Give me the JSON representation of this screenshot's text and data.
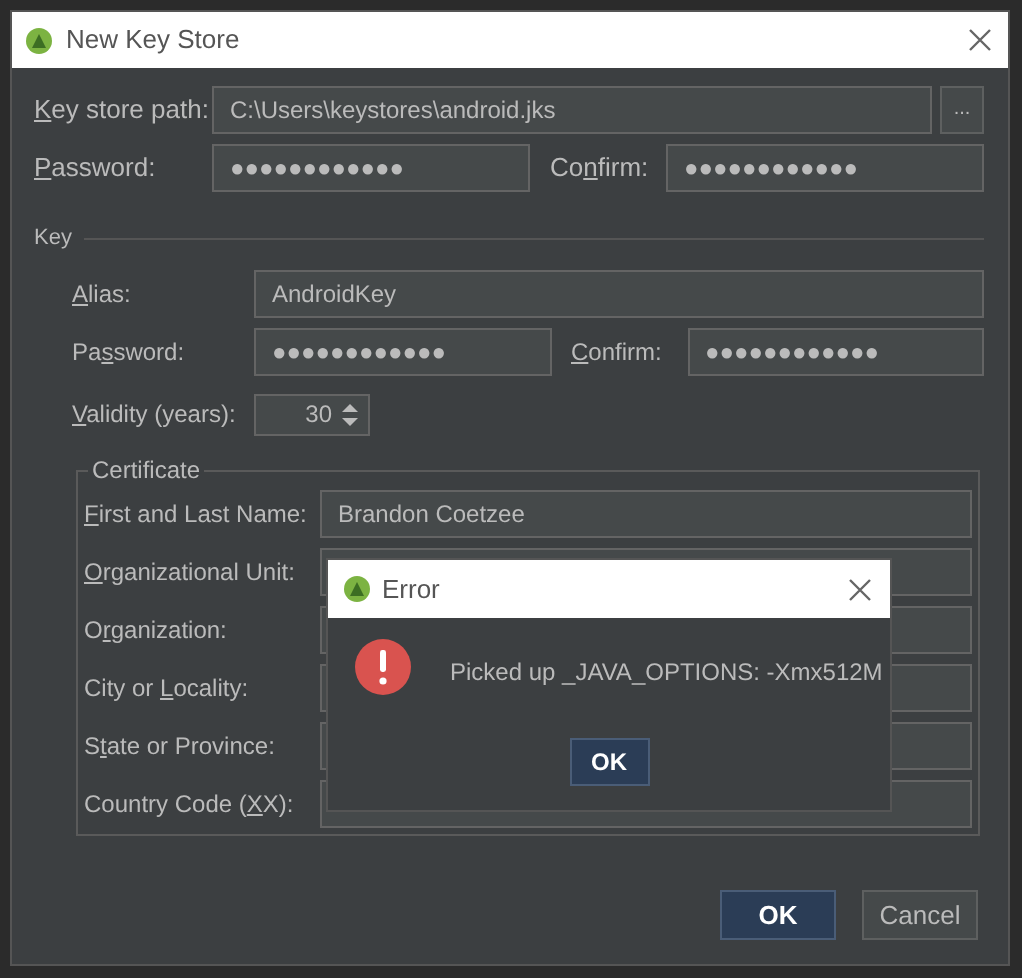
{
  "window": {
    "title": "New Key Store"
  },
  "key_store": {
    "path": {
      "mnemonic": "K",
      "label_post": "ey store path:",
      "value": "C:\\Users\\keystores\\android.jks"
    },
    "browse_button": "...",
    "password": {
      "mnemonic": "P",
      "label_post": "assword:",
      "value": "●●●●●●●●●●●●"
    },
    "confirm": {
      "label_pre": "Co",
      "mnemonic": "n",
      "label_post": "firm:",
      "value": "●●●●●●●●●●●●"
    }
  },
  "key": {
    "title": "Key",
    "alias": {
      "mnemonic": "A",
      "label_post": "lias:",
      "value": "AndroidKey"
    },
    "password": {
      "label_pre": "Pa",
      "mnemonic": "s",
      "label_post": "sword:",
      "value": "●●●●●●●●●●●●"
    },
    "confirm": {
      "mnemonic": "C",
      "label_post": "onfirm:",
      "value": "●●●●●●●●●●●●"
    },
    "validity": {
      "mnemonic": "V",
      "label_post": "alidity (years):",
      "value": "30"
    },
    "certificate": {
      "title": "Certificate",
      "fields": [
        {
          "mnemonic": "F",
          "label_post": "irst and Last Name:",
          "value": "Brandon Coetzee"
        },
        {
          "mnemonic": "O",
          "label_post": "rganizational Unit:"
        },
        {
          "label_pre": "O",
          "mnemonic": "r",
          "label_post": "ganization:"
        },
        {
          "label_pre": "City or ",
          "mnemonic": "L",
          "label_post": "ocality:"
        },
        {
          "label_pre": "S",
          "mnemonic": "t",
          "label_post": "ate or Province:"
        },
        {
          "label_pre": "Country Code (",
          "mnemonic": "X",
          "label_post": "X):"
        }
      ]
    }
  },
  "buttons": [
    {
      "label": "OK",
      "default": true
    },
    {
      "label": "Cancel",
      "default": false
    }
  ],
  "error_dialog": {
    "title": "Error",
    "message": "Picked up _JAVA_OPTIONS: -Xmx512M",
    "button": "OK"
  }
}
